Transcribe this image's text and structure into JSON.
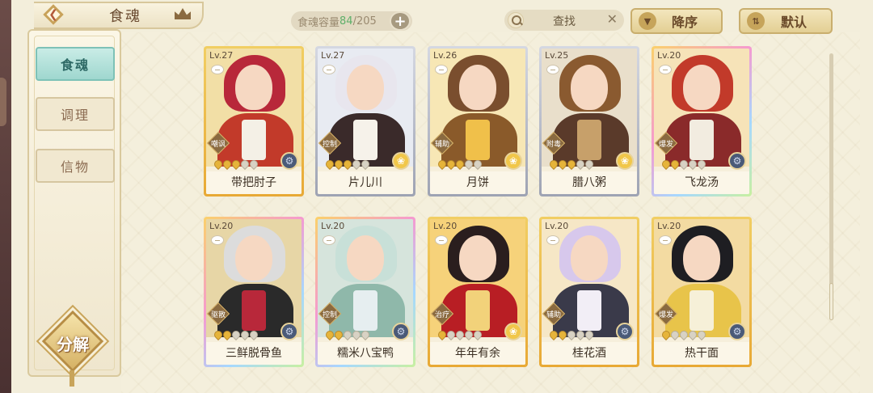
{
  "header": {
    "title": "食魂",
    "capacity_label": "食魂容量",
    "capacity_used": "84",
    "capacity_total": "/205",
    "plus": "+",
    "search_label": "查找",
    "search_clear": "✕",
    "sort_order_label": "降序",
    "sort_default_label": "默认"
  },
  "sidebar": {
    "tabs": [
      {
        "label": "食魂",
        "active": true
      },
      {
        "label": "调理",
        "active": false
      },
      {
        "label": "信物",
        "active": false
      }
    ],
    "decompose_label": "分解"
  },
  "cards": [
    {
      "level": "Lv.27",
      "name": "带把肘子",
      "role": "嘲讽",
      "stars": 3,
      "element": "gear",
      "frame": "gold",
      "hair": "#b8283a",
      "body": "#c23a2a",
      "accent": "#f4f0e6",
      "bg": "#f2dfa6"
    },
    {
      "level": "Lv.27",
      "name": "片儿川",
      "role": "控制",
      "stars": 3,
      "element": "flower",
      "frame": "silver",
      "hair": "#e8e6ee",
      "body": "#3a2a2a",
      "accent": "#f6f2ea",
      "bg": "#e8ebf2"
    },
    {
      "level": "Lv.26",
      "name": "月饼",
      "role": "辅助",
      "stars": 3,
      "element": "flower",
      "frame": "silver",
      "hair": "#7a4e2e",
      "body": "#8a5a2a",
      "accent": "#f0c04a",
      "bg": "#f7e7b5"
    },
    {
      "level": "Lv.25",
      "name": "腊八粥",
      "role": "附毒",
      "stars": 3,
      "element": "flower",
      "frame": "silver",
      "hair": "#8a5a30",
      "body": "#5a3a2a",
      "accent": "#c7a06a",
      "bg": "#e9dfcb"
    },
    {
      "level": "Lv.20",
      "name": "飞龙汤",
      "role": "爆发",
      "stars": 2,
      "element": "gear",
      "frame": "rainbow",
      "hair": "#c23a2a",
      "body": "#8a2a2a",
      "accent": "#f2ece0",
      "bg": "#f6e3b8"
    },
    {
      "level": "Lv.20",
      "name": "三鲜脱骨鱼",
      "role": "驱散",
      "stars": 2,
      "element": "gear",
      "frame": "rainbow",
      "hair": "#dcdcdc",
      "body": "#2a2a2a",
      "accent": "#b8283a",
      "bg": "#e7d6a6"
    },
    {
      "level": "Lv.20",
      "name": "糯米八宝鸭",
      "role": "控制",
      "stars": 2,
      "element": "gear",
      "frame": "rainbow",
      "hair": "#c8e0d8",
      "body": "#8fb8aa",
      "accent": "#e6eef0",
      "bg": "#d6e4dc"
    },
    {
      "level": "Lv.20",
      "name": "年年有余",
      "role": "治疗",
      "stars": 1,
      "element": "flower",
      "frame": "gold",
      "hair": "#2a1e1e",
      "body": "#b81e24",
      "accent": "#f2d27a",
      "bg": "#f6d27a"
    },
    {
      "level": "Lv.20",
      "name": "桂花酒",
      "role": "辅助",
      "stars": 2,
      "element": "gear",
      "frame": "gold",
      "hair": "#d7c8ec",
      "body": "#3a3a4a",
      "accent": "#f2eef6",
      "bg": "#f6e7c6"
    },
    {
      "level": "Lv.20",
      "name": "热干面",
      "role": "爆发",
      "stars": 1,
      "element": "gear",
      "frame": "gold",
      "hair": "#1e1e22",
      "body": "#e8c44a",
      "accent": "#f6f0d8",
      "bg": "#f3dba2"
    }
  ]
}
